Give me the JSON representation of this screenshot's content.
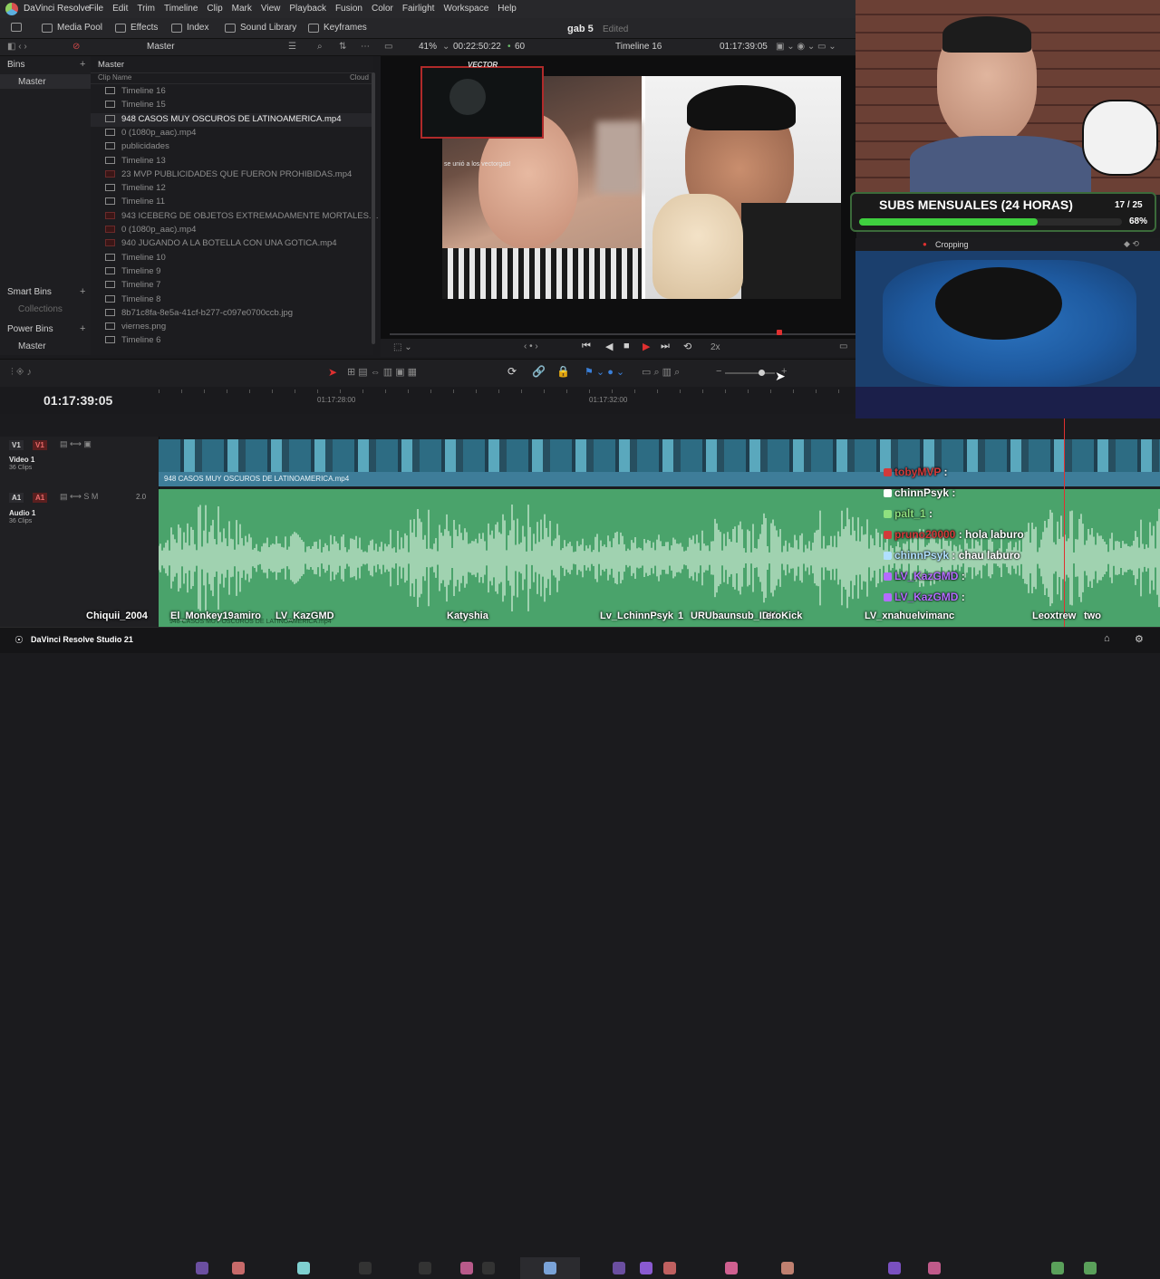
{
  "app": {
    "name": "DaVinci Resolve",
    "menus": [
      "File",
      "Edit",
      "Trim",
      "Timeline",
      "Clip",
      "Mark",
      "View",
      "Playback",
      "Fusion",
      "Color",
      "Fairlight",
      "Workspace",
      "Help"
    ],
    "project_title": "gab 5",
    "project_status": "Edited"
  },
  "toolbar": {
    "media_pool": "Media Pool",
    "effects": "Effects",
    "index": "Index",
    "sound_library": "Sound Library",
    "keyframes": "Keyframes"
  },
  "pool": {
    "current_bin": "Master",
    "bins_label": "Bins",
    "master": "Master",
    "smart_bins": "Smart Bins",
    "collections": "Collections",
    "power_bins": "Power Bins",
    "power_master": "Master",
    "breadcrumb": "Master",
    "col_clip_name": "Clip Name",
    "col_cloud": "Cloud",
    "clips": [
      {
        "name": "Timeline 16",
        "kind": "timeline"
      },
      {
        "name": "Timeline 15",
        "kind": "timeline"
      },
      {
        "name": "948 CASOS MUY OSCUROS DE LATINOAMERICA.mp4",
        "kind": "video",
        "selected": true
      },
      {
        "name": "0 (1080p_aac).mp4",
        "kind": "video"
      },
      {
        "name": "publicidades",
        "kind": "timeline"
      },
      {
        "name": "Timeline 13",
        "kind": "timeline"
      },
      {
        "name": "23 MVP PUBLICIDADES QUE FUERON PROHIBIDAS.mp4",
        "kind": "red"
      },
      {
        "name": "Timeline 12",
        "kind": "timeline"
      },
      {
        "name": "Timeline 11",
        "kind": "timeline"
      },
      {
        "name": "943 ICEBERG DE OBJETOS EXTREMADAMENTE MORTALES....",
        "kind": "red"
      },
      {
        "name": "0 (1080p_aac).mp4",
        "kind": "red"
      },
      {
        "name": "940 JUGANDO A LA BOTELLA CON UNA GOTICA.mp4",
        "kind": "red"
      },
      {
        "name": "Timeline 10",
        "kind": "timeline"
      },
      {
        "name": "Timeline 9",
        "kind": "timeline"
      },
      {
        "name": "Timeline 7",
        "kind": "timeline"
      },
      {
        "name": "Timeline 8",
        "kind": "timeline"
      },
      {
        "name": "8b71c8fa-8e5a-41cf-b277-c097e0700ccb.jpg",
        "kind": "image"
      },
      {
        "name": "viernes.png",
        "kind": "image"
      },
      {
        "name": "Timeline 6",
        "kind": "timeline"
      }
    ]
  },
  "viewer": {
    "zoom": "41%",
    "duration": "00:22:50:22",
    "fps": "60",
    "timeline_name": "Timeline 16",
    "timecode": "01:17:39:05",
    "speed": "2x",
    "stream_name": "VECTOR",
    "stream_caption": "se unió a los vectorgas!"
  },
  "timeline": {
    "timecode": "01:17:39:05",
    "ticks": [
      "01:17:28:00",
      "01:17:32:00"
    ],
    "v1": "V1",
    "a1": "A1",
    "video_track_name": "Video 1",
    "video_track_count": "36 Clips",
    "audio_track_name": "Audio 1",
    "audio_track_count": "36 Clips",
    "audio_level": "2.0",
    "clip_label": "948 CASOS MUY OSCUROS DE LATINOAMERICA.mp4",
    "audio_clip_label": "948 CASOS MUY OSCUROS DE LATINOAMERICA.mp4"
  },
  "overlay": {
    "subs_title": "SUBS MENSUALES (24 HORAS)",
    "subs_count": "17 / 25",
    "subs_percent": 68,
    "subs_percent_label": "68%",
    "cam2_label": "Cropping"
  },
  "chat": [
    {
      "user": "tobyMVP",
      "sep": " :",
      "msg": "",
      "color": "#d23a3a"
    },
    {
      "user": "chinnPsyk",
      "sep": " :",
      "msg": "",
      "color": "#ffffff"
    },
    {
      "user": "palt_1",
      "sep": " :",
      "msg": "",
      "color": "#8fe07f"
    },
    {
      "user": "pruno20000",
      "sep": " :",
      "msg": " hola laburo",
      "color": "#d23a3a"
    },
    {
      "user": "chinnPsyk",
      "sep": " :",
      "msg": " chau laburo",
      "color": "#b0e0ff"
    },
    {
      "user": "LV_KazGMD",
      "sep": " :",
      "msg": "",
      "color": "#b46cff"
    },
    {
      "user": "LV_KazGMD",
      "sep": " :",
      "msg": "",
      "color": "#b46cff"
    }
  ],
  "nicknames": [
    "Chiquii_2004",
    "El_Monkey19",
    "amiro",
    "LV_KazGMD",
    "Katyshia",
    "Lv_L",
    "chinnPsyk",
    "1",
    "URUbaunsub_IDK",
    "eroKick",
    "LV_xnahu",
    "elvimanc",
    "Leoxtrew",
    "two"
  ],
  "taskbar": {
    "app_label": "DaVinci Resolve Studio 21"
  },
  "colors": {
    "accent_red": "#e03030",
    "video_track": "#3e7d99",
    "audio_track": "#4aa36b",
    "progress_green": "#3fcf3f"
  }
}
